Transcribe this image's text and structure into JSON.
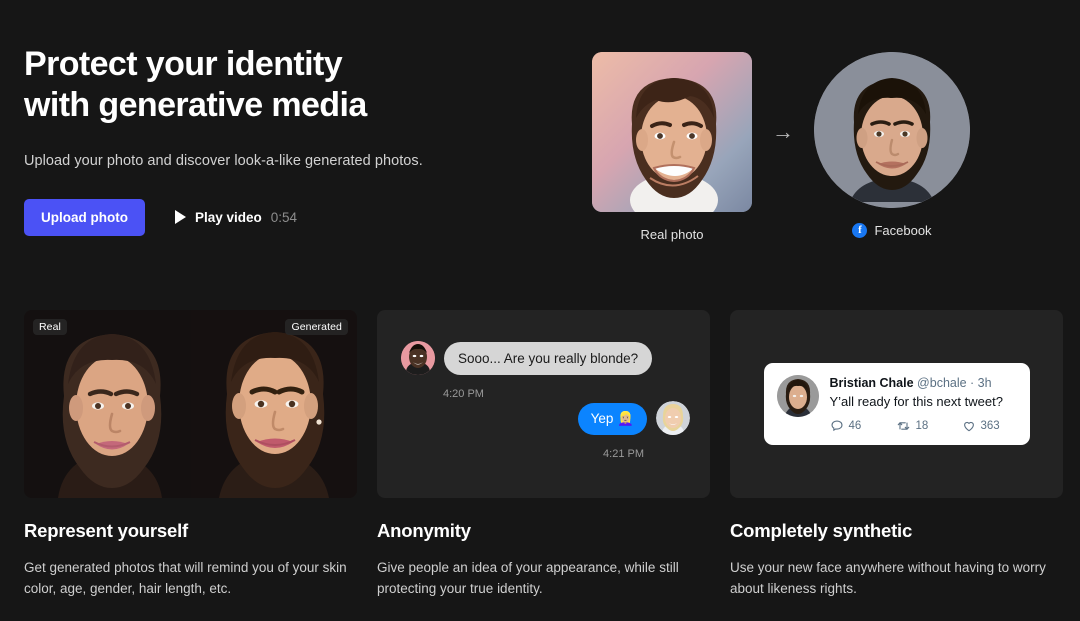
{
  "hero": {
    "title_line1": "Protect your identity",
    "title_line2": "with generative media",
    "subtitle": "Upload your photo and discover look-a-like generated photos.",
    "upload_button": "Upload photo",
    "play_label": "Play video",
    "play_duration": "0:54",
    "accent_color": "#4b52f5",
    "real_caption": "Real photo",
    "generated_caption": "Facebook",
    "arrow_glyph": "→",
    "facebook_glyph": "f"
  },
  "cards": [
    {
      "title": "Represent yourself",
      "body": "Get generated photos that will remind you of your skin color, age, gender, hair length, etc.",
      "tag_left": "Real",
      "tag_right": "Generated"
    },
    {
      "title": "Anonymity",
      "body": "Give people an idea of your appearance, while still protecting your true identity.",
      "chat": {
        "incoming_text": "Sooo... Are you really blonde?",
        "incoming_time": "4:20 PM",
        "outgoing_text": "Yep 👱🏼‍♀️",
        "outgoing_time": "4:21 PM"
      }
    },
    {
      "title": "Completely synthetic",
      "body": "Use your new face anywhere without having to worry about likeness rights.",
      "tweet": {
        "name": "Bristian Chale",
        "handle": "@bchale · 3h",
        "text": "Y’all ready for this next tweet?",
        "replies": "46",
        "retweets": "18",
        "likes": "363"
      }
    }
  ]
}
